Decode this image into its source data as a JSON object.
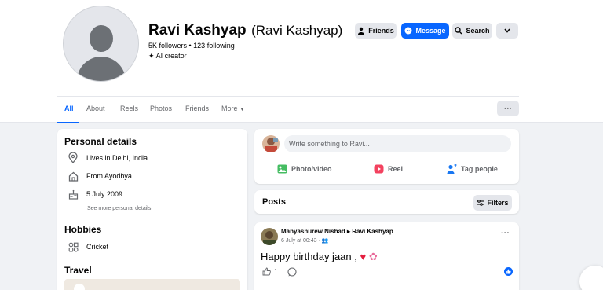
{
  "profile": {
    "name": "Ravi Kashyap",
    "alt_name": "(Ravi Kashyap)",
    "followers": "5K followers • 123 following",
    "creator_label": "AI creator"
  },
  "actions": {
    "friends": "Friends",
    "message": "Message",
    "search": "Search"
  },
  "tabs": [
    {
      "label": "All"
    },
    {
      "label": "About"
    },
    {
      "label": "Reels"
    },
    {
      "label": "Photos"
    },
    {
      "label": "Friends"
    },
    {
      "label": "More"
    }
  ],
  "personal_details": {
    "title": "Personal details",
    "items": [
      {
        "icon": "location-pin-icon",
        "text": "Lives in Delhi, India"
      },
      {
        "icon": "home-icon",
        "text": "From Ayodhya"
      },
      {
        "icon": "birthday-cake-icon",
        "text": "5 July 2009"
      }
    ],
    "see_more": "See more personal details"
  },
  "hobbies": {
    "title": "Hobbies",
    "items": [
      {
        "icon": "hobbies-grid-icon",
        "text": "Cricket"
      }
    ]
  },
  "travel": {
    "title": "Travel"
  },
  "composer": {
    "placeholder": "Write something to Ravi...",
    "actions": [
      "Photo/video",
      "Reel",
      "Tag people"
    ]
  },
  "posts": {
    "title": "Posts",
    "filters": "Filters"
  },
  "post": {
    "author": "Manyasnurew Nishad ▸ Ravi Kashyap",
    "time": "6 July at 00:43 · ",
    "text": "Happy birthday jaan ,",
    "like_count": "1"
  },
  "colors": {
    "accent": "#0866ff",
    "page_bg": "#f0f2f5",
    "card_bg": "#ffffff",
    "button_gray": "#e4e6eb",
    "secondary_text": "#65676b"
  }
}
